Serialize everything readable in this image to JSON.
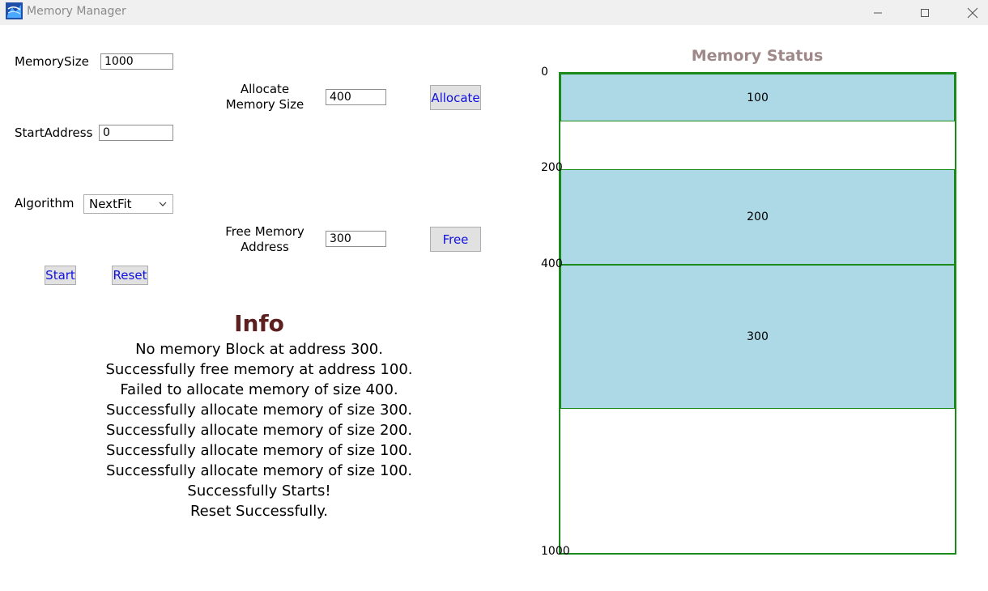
{
  "window": {
    "title": "Memory Manager",
    "icons": {
      "app": "app-icon",
      "minimize": "minimize-icon",
      "maximize": "maximize-icon",
      "close": "close-icon"
    }
  },
  "form": {
    "memory_size_label": "MemorySize",
    "memory_size_value": "1000",
    "start_address_label": "StartAddress",
    "start_address_value": "0",
    "algorithm_label": "Algorithm",
    "algorithm_value": "NextFit",
    "allocate_size_label_1": "Allocate",
    "allocate_size_label_2": "Memory Size",
    "allocate_size_value": "400",
    "allocate_button": "Allocate",
    "free_address_label_1": "Free Memory",
    "free_address_label_2": "Address",
    "free_address_value": "300",
    "free_button": "Free",
    "start_button": "Start",
    "reset_button": "Reset"
  },
  "info": {
    "title": "Info",
    "lines": [
      "No memory Block at address 300.",
      "Successfully free memory at address 100.",
      "Failed to allocate memory of size 400.",
      "Successfully allocate memory of size 300.",
      "Successfully allocate memory of size 200.",
      "Successfully allocate memory of size 100.",
      "Successfully allocate memory of size 100.",
      "Successfully Starts!",
      "Reset Successfully."
    ]
  },
  "memory": {
    "title": "Memory Status",
    "total": 1000,
    "axis_labels": [
      "0",
      "200",
      "400",
      "1000"
    ],
    "blocks": [
      {
        "label": "100",
        "start": 0,
        "size": 100
      },
      {
        "label": "200",
        "start": 200,
        "size": 200
      },
      {
        "label": "300",
        "start": 400,
        "size": 300
      }
    ],
    "colors": {
      "block_fill": "#add8e6",
      "border": "#1a8a1a"
    }
  }
}
